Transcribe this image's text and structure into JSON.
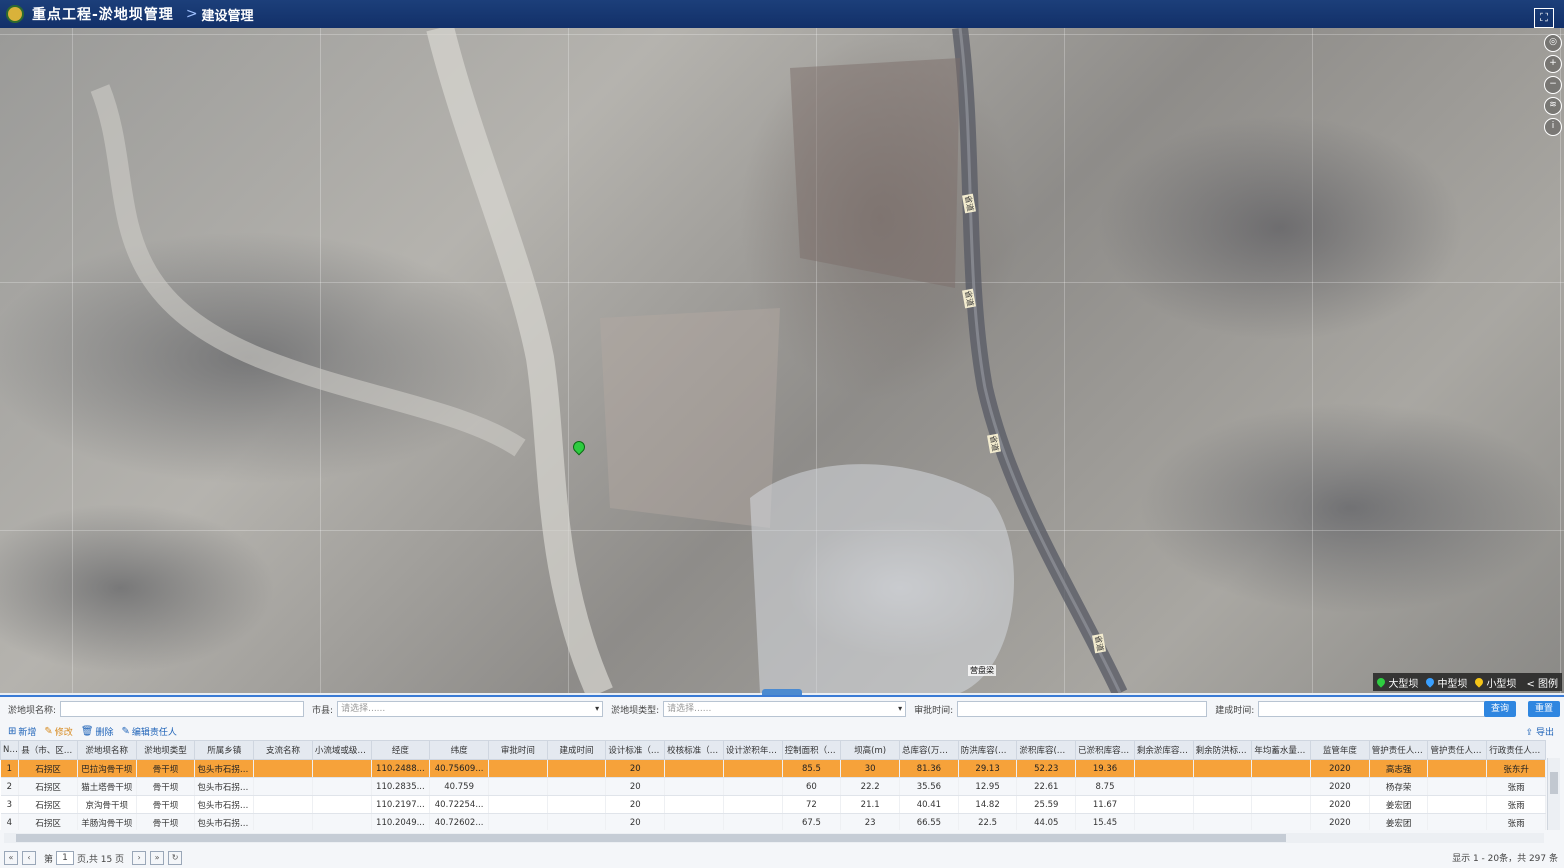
{
  "header": {
    "title": "重点工程-淤地坝管理",
    "breadcrumb_sep": ">",
    "breadcrumb": "建设管理"
  },
  "map": {
    "tools": [
      "globe-icon",
      "zoom-in-icon",
      "zoom-out-icon",
      "layers-icon",
      "info-icon"
    ],
    "legend": {
      "items": [
        {
          "label": "大型坝",
          "color": "#2ecc40"
        },
        {
          "label": "中型坝",
          "color": "#3aa0ff"
        },
        {
          "label": "小型坝",
          "color": "#f5c518"
        }
      ],
      "toggle_label": "< 图例"
    },
    "place_label": "营盘梁"
  },
  "filters": {
    "name_label": "淤地坝名称:",
    "city_label": "市县:",
    "city_placeholder": "请选择......",
    "type_label": "淤地坝类型:",
    "type_placeholder": "请选择......",
    "approve_label": "审批时间:",
    "build_label": "建成时间:",
    "query": "查询",
    "reset": "重置"
  },
  "toolbar": {
    "add": "新增",
    "edit": "修改",
    "delete": "删除",
    "edit_owner": "编辑责任人",
    "export": "导出"
  },
  "table": {
    "columns": [
      "No.",
      "县（市、区）...",
      "淤地坝名称",
      "淤地坝类型",
      "所属乡镇",
      "支流名称",
      "小流域或级系...",
      "经度",
      "纬度",
      "审批时间",
      "建成时间",
      "设计标准（年）",
      "校核标准（年）",
      "设计淤积年限...",
      "控制面积（k...",
      "坝高(m)",
      "总库容(万m3)",
      "防洪库容(万m3)",
      "淤积库容(万m3)",
      "已淤积库容(万...",
      "剩余淤库容(万...",
      "剩余防洪标准...",
      "年均蓄水量(万...",
      "监管年度",
      "管护责任人姓名",
      "管护责任人电话",
      "行政责任人姓名"
    ],
    "rows": [
      [
        "1",
        "石拐区",
        "巴拉沟骨干坝",
        "骨干坝",
        "包头市石拐区...",
        "",
        "",
        "110.2488...",
        "40.75609...",
        "",
        "",
        "20",
        "",
        "",
        "85.5",
        "30",
        "81.36",
        "29.13",
        "52.23",
        "19.36",
        "",
        "",
        "",
        "2020",
        "高志强",
        "",
        "张东升"
      ],
      [
        "2",
        "石拐区",
        "猫土塔骨干坝",
        "骨干坝",
        "包头市石拐区...",
        "",
        "",
        "110.2835...",
        "40.759",
        "",
        "",
        "20",
        "",
        "",
        "60",
        "22.2",
        "35.56",
        "12.95",
        "22.61",
        "8.75",
        "",
        "",
        "",
        "2020",
        "杨存荣",
        "",
        "张雨"
      ],
      [
        "3",
        "石拐区",
        "京沟骨干坝",
        "骨干坝",
        "包头市石拐区...",
        "",
        "",
        "110.2197...",
        "40.72254...",
        "",
        "",
        "20",
        "",
        "",
        "72",
        "21.1",
        "40.41",
        "14.82",
        "25.59",
        "11.67",
        "",
        "",
        "",
        "2020",
        "姜宏团",
        "",
        "张雨"
      ],
      [
        "4",
        "石拐区",
        "羊肠沟骨干坝",
        "骨干坝",
        "包头市石拐区...",
        "",
        "",
        "110.2049...",
        "40.72602...",
        "",
        "",
        "20",
        "",
        "",
        "67.5",
        "23",
        "66.55",
        "22.5",
        "44.05",
        "15.45",
        "",
        "",
        "",
        "2020",
        "姜宏团",
        "",
        "张雨"
      ]
    ]
  },
  "pager": {
    "page_prefix": "第",
    "page": "1",
    "page_suffix": "页,共 15 页",
    "summary": "显示 1 - 20条，共 297 条"
  }
}
